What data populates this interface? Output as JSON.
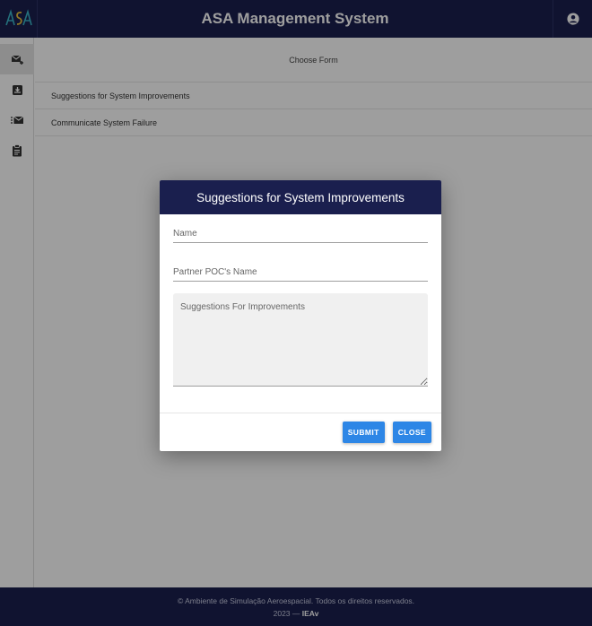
{
  "app": {
    "title": "ASA Management System",
    "logo_text": "ASA"
  },
  "sidebar": {
    "items": [
      {
        "icon": "mail-plus-icon"
      },
      {
        "icon": "inbox-download-icon"
      },
      {
        "icon": "mail-list-icon"
      },
      {
        "icon": "clipboard-icon"
      }
    ]
  },
  "main": {
    "header": "Choose Form",
    "forms": [
      {
        "label": "Suggestions for System Improvements"
      },
      {
        "label": "Communicate System Failure"
      }
    ]
  },
  "modal": {
    "title": "Suggestions for System Improvements",
    "name_placeholder": "Name",
    "poc_placeholder": "Partner POC's Name",
    "suggestions_placeholder": "Suggestions For Improvements",
    "submit_label": "SUBMIT",
    "close_label": "CLOSE"
  },
  "footer": {
    "line1": "© Ambiente de Simulação Aeroespacial. Todos os direitos reservados.",
    "year": "2023 — ",
    "org": "IEAv"
  },
  "colors": {
    "navy": "#1a1f4e",
    "button": "#2d86e6"
  }
}
